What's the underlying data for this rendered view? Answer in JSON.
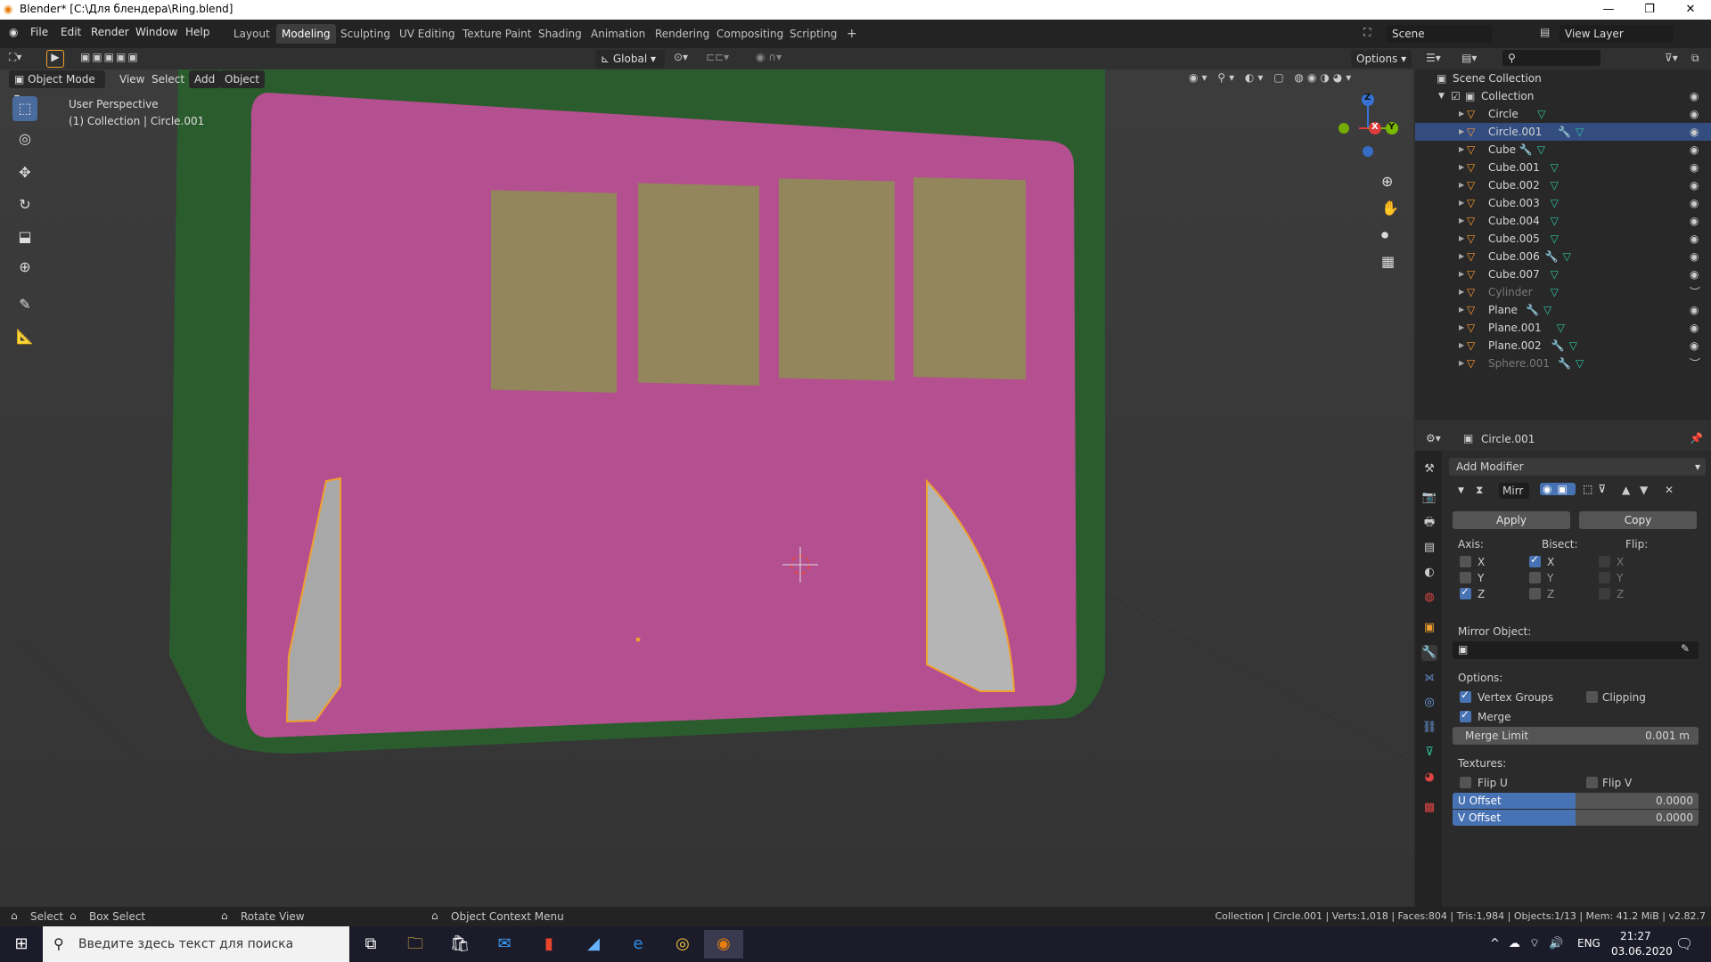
{
  "window": {
    "title": "Blender* [C:\\Для блендера\\Ring.blend]",
    "minimize": "—",
    "maximize": "❐",
    "close": "✕"
  },
  "menu": {
    "items": [
      "File",
      "Edit",
      "Render",
      "Window",
      "Help"
    ]
  },
  "workspaces": {
    "tabs": [
      "Layout",
      "Modeling",
      "Sculpting",
      "UV Editing",
      "Texture Paint",
      "Shading",
      "Animation",
      "Rendering",
      "Compositing",
      "Scripting"
    ],
    "active": "Modeling",
    "add": "+"
  },
  "scene": {
    "label": "Scene",
    "view_layer": "View Layer"
  },
  "viewport_header": {
    "orientation": "Global",
    "options": "Options",
    "mode": "Object Mode",
    "menus": [
      "View",
      "Select",
      "Add",
      "Object"
    ]
  },
  "viewport": {
    "perspective": "User Perspective",
    "context": "(1) Collection | Circle.001",
    "gizmo": {
      "z": "Z",
      "x": "X",
      "y": "Y"
    },
    "colors": {
      "background": "#3a3a3a",
      "green": "#2b5c2e",
      "pink": "#b4508f",
      "tan": "#93855c",
      "gray": "#aeaeae",
      "selection": "#f0a030"
    }
  },
  "outliner": {
    "root": "Scene Collection",
    "collection": "Collection",
    "items": [
      {
        "name": "Circle",
        "selected": false,
        "dim": false,
        "wrench": false
      },
      {
        "name": "Circle.001",
        "selected": true,
        "dim": false,
        "wrench": true
      },
      {
        "name": "Cube",
        "selected": false,
        "dim": false,
        "wrench": true
      },
      {
        "name": "Cube.001",
        "selected": false,
        "dim": false,
        "wrench": false
      },
      {
        "name": "Cube.002",
        "selected": false,
        "dim": false,
        "wrench": false
      },
      {
        "name": "Cube.003",
        "selected": false,
        "dim": false,
        "wrench": false
      },
      {
        "name": "Cube.004",
        "selected": false,
        "dim": false,
        "wrench": false
      },
      {
        "name": "Cube.005",
        "selected": false,
        "dim": false,
        "wrench": false
      },
      {
        "name": "Cube.006",
        "selected": false,
        "dim": false,
        "wrench": true
      },
      {
        "name": "Cube.007",
        "selected": false,
        "dim": false,
        "wrench": false
      },
      {
        "name": "Cylinder",
        "selected": false,
        "dim": true,
        "wrench": false
      },
      {
        "name": "Plane",
        "selected": false,
        "dim": false,
        "wrench": true
      },
      {
        "name": "Plane.001",
        "selected": false,
        "dim": false,
        "wrench": false
      },
      {
        "name": "Plane.002",
        "selected": false,
        "dim": false,
        "wrench": true
      },
      {
        "name": "Sphere.001",
        "selected": false,
        "dim": true,
        "wrench": true
      }
    ]
  },
  "properties": {
    "object": "Circle.001",
    "add_modifier": "Add Modifier",
    "modifier_name": "Mirr",
    "apply": "Apply",
    "copy": "Copy",
    "axis_label": "Axis:",
    "bisect_label": "Bisect:",
    "flip_label": "Flip:",
    "axis": {
      "x": false,
      "y": false,
      "z": true
    },
    "bisect": {
      "x": true,
      "y": false,
      "z": false
    },
    "flip": {
      "x": false,
      "y": false,
      "z": false
    },
    "axis_names": [
      "X",
      "Y",
      "Z"
    ],
    "mirror_object": "Mirror Object:",
    "options_label": "Options:",
    "vertex_groups": "Vertex Groups",
    "vertex_groups_on": true,
    "clipping": "Clipping",
    "clipping_on": false,
    "merge": "Merge",
    "merge_on": true,
    "merge_limit_label": "Merge Limit",
    "merge_limit": "0.001 m",
    "textures_label": "Textures:",
    "flip_u": "Flip U",
    "flip_v": "Flip V",
    "u_offset_label": "U Offset",
    "u_offset": "0.0000",
    "v_offset_label": "V Offset",
    "v_offset": "0.0000"
  },
  "statusbar": {
    "select": "Select",
    "box_select": "Box Select",
    "rotate": "Rotate View",
    "context_menu": "Object Context Menu",
    "stats": "Collection | Circle.001 | Verts:1,018 | Faces:804 | Tris:1,984 | Objects:1/13 | Mem: 41.2 MiB | v2.82.7"
  },
  "taskbar": {
    "search_placeholder": "Введите здесь текст для поиска",
    "lang": "ENG",
    "time": "21:27",
    "date": "03.06.2020"
  }
}
